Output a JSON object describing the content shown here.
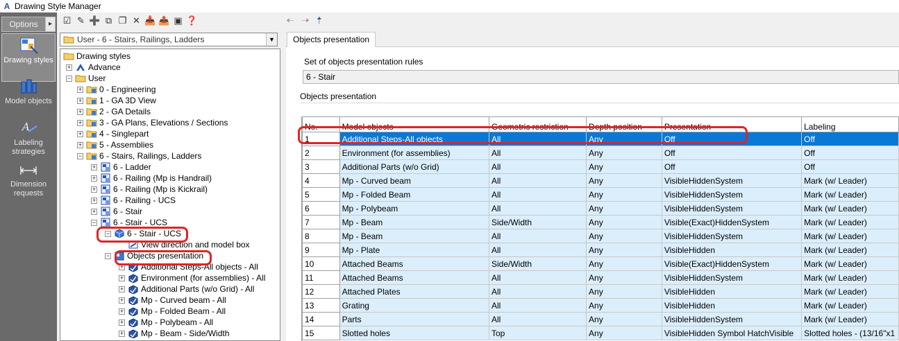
{
  "window": {
    "title": "Drawing Style Manager"
  },
  "colors": {
    "accent": "#0a78d7",
    "row_bg": "#dbeefc",
    "highlight": "#e02424",
    "strip": "#6a6a6a"
  },
  "left_strip": {
    "options_label": "Options",
    "items": [
      {
        "label": "Drawing styles",
        "icon": "drawing-styles-icon",
        "active": true
      },
      {
        "label": "Model objects",
        "icon": "model-objects-icon",
        "active": false
      },
      {
        "label": "Labeling strategies",
        "icon": "labeling-strategies-icon",
        "active": false
      },
      {
        "label": "Dimension requests",
        "icon": "dimension-requests-icon",
        "active": false
      }
    ]
  },
  "left_toolbar": {
    "icons": [
      "checklist-icon",
      "edit-icon",
      "new-icon",
      "copy-icon",
      "paste-icon",
      "delete-icon",
      "import-icon",
      "export-icon",
      "preview-icon",
      "help-icon"
    ]
  },
  "style_combo": {
    "value": "User - 6 - Stairs, Railings, Ladders"
  },
  "tree": {
    "root": "Drawing styles",
    "nodes": [
      {
        "label": "Advance",
        "level": 1,
        "exp": "+",
        "icon": "advance"
      },
      {
        "label": "User",
        "level": 1,
        "exp": "-",
        "icon": "folder-open"
      },
      {
        "label": "0 - Engineering",
        "level": 2,
        "exp": "+",
        "icon": "folder-style"
      },
      {
        "label": "1 - GA 3D View",
        "level": 2,
        "exp": "+",
        "icon": "folder-style"
      },
      {
        "label": "2 - GA Details",
        "level": 2,
        "exp": "+",
        "icon": "folder-style"
      },
      {
        "label": "3 - GA Plans, Elevations / Sections",
        "level": 2,
        "exp": "+",
        "icon": "folder-style"
      },
      {
        "label": "4 - Singlepart",
        "level": 2,
        "exp": "+",
        "icon": "folder-style"
      },
      {
        "label": "5 - Assemblies",
        "level": 2,
        "exp": "+",
        "icon": "folder-style"
      },
      {
        "label": "6 - Stairs, Railings, Ladders",
        "level": 2,
        "exp": "-",
        "icon": "folder-style"
      },
      {
        "label": "6 - Ladder",
        "level": 3,
        "exp": "+",
        "icon": "style"
      },
      {
        "label": "6 - Railing (Mp is Handrail)",
        "level": 3,
        "exp": "+",
        "icon": "style"
      },
      {
        "label": "6 - Railing (Mp is Kickrail)",
        "level": 3,
        "exp": "+",
        "icon": "style"
      },
      {
        "label": "6 - Railing - UCS",
        "level": 3,
        "exp": "+",
        "icon": "style"
      },
      {
        "label": "6 - Stair",
        "level": 3,
        "exp": "+",
        "icon": "style"
      },
      {
        "label": "6 - Stair - UCS",
        "level": 3,
        "exp": "-",
        "icon": "style"
      },
      {
        "label": "6 - Stair - UCS",
        "level": 4,
        "exp": "-",
        "icon": "cube"
      },
      {
        "label": "View direction and model box",
        "level": 5,
        "exp": "",
        "icon": "view"
      },
      {
        "label": "Objects presentation",
        "level": 4,
        "exp": "-",
        "icon": "presentation"
      },
      {
        "label": "Additional Steps-All objects - All",
        "level": 5,
        "exp": "+",
        "icon": "rule"
      },
      {
        "label": "Environment (for assemblies) - All",
        "level": 5,
        "exp": "+",
        "icon": "rule"
      },
      {
        "label": "Additional Parts (w/o Grid) - All",
        "level": 5,
        "exp": "+",
        "icon": "rule"
      },
      {
        "label": "Mp - Curved beam - All",
        "level": 5,
        "exp": "+",
        "icon": "rule"
      },
      {
        "label": "Mp - Folded Beam - All",
        "level": 5,
        "exp": "+",
        "icon": "rule"
      },
      {
        "label": "Mp - Polybeam - All",
        "level": 5,
        "exp": "+",
        "icon": "rule"
      },
      {
        "label": "Mp - Beam - Side/Width",
        "level": 5,
        "exp": "+",
        "icon": "rule"
      }
    ]
  },
  "right": {
    "tab_label": "Objects presentation",
    "set_label": "Set of objects presentation rules",
    "set_value": "6 - Stair",
    "group_label": "Objects presentation",
    "columns": [
      "No.",
      "Model objects",
      "Geometric restriction",
      "Depth position",
      "Presentation",
      "Labeling"
    ],
    "rows": [
      [
        "1",
        "Additional Steps-All objects",
        "All",
        "Any",
        "Off",
        "Off"
      ],
      [
        "2",
        "Environment (for assemblies)",
        "All",
        "Any",
        "Off",
        "Off"
      ],
      [
        "3",
        "Additional Parts (w/o Grid)",
        "All",
        "Any",
        "Off",
        "Off"
      ],
      [
        "4",
        "Mp - Curved beam",
        "All",
        "Any",
        "VisibleHiddenSystem",
        "Mark (w/ Leader)"
      ],
      [
        "5",
        "Mp - Folded Beam",
        "All",
        "Any",
        "VisibleHiddenSystem",
        "Mark (w/ Leader)"
      ],
      [
        "6",
        "Mp - Polybeam",
        "All",
        "Any",
        "VisibleHiddenSystem",
        "Mark (w/ Leader)"
      ],
      [
        "7",
        "Mp - Beam",
        "Side/Width",
        "Any",
        "Visible(Exact)HiddenSystem",
        "Mark (w/ Leader)"
      ],
      [
        "8",
        "Mp - Beam",
        "All",
        "Any",
        "VisibleHiddenSystem",
        "Mark (w/ Leader)"
      ],
      [
        "9",
        "Mp - Plate",
        "All",
        "Any",
        "VisibleHidden",
        "Mark (w/ Leader)"
      ],
      [
        "10",
        "Attached Beams",
        "Side/Width",
        "Any",
        "Visible(Exact)HiddenSystem",
        "Mark (w/ Leader)"
      ],
      [
        "11",
        "Attached Beams",
        "All",
        "Any",
        "VisibleHiddenSystem",
        "Mark (w/ Leader)"
      ],
      [
        "12",
        "Attached Plates",
        "All",
        "Any",
        "VisibleHidden",
        "Mark (w/ Leader)"
      ],
      [
        "13",
        "Grating",
        "All",
        "Any",
        "VisibleHidden",
        "Mark (w/ Leader)"
      ],
      [
        "14",
        "Parts",
        "All",
        "Any",
        "VisibleHiddenSystem",
        "Mark (w/ Leader)"
      ],
      [
        "15",
        "Slotted holes",
        "Top",
        "Any",
        "VisibleHidden Symbol HatchVisible",
        "Slotted holes - (13/16\"x1"
      ]
    ],
    "selected_row": 1
  }
}
